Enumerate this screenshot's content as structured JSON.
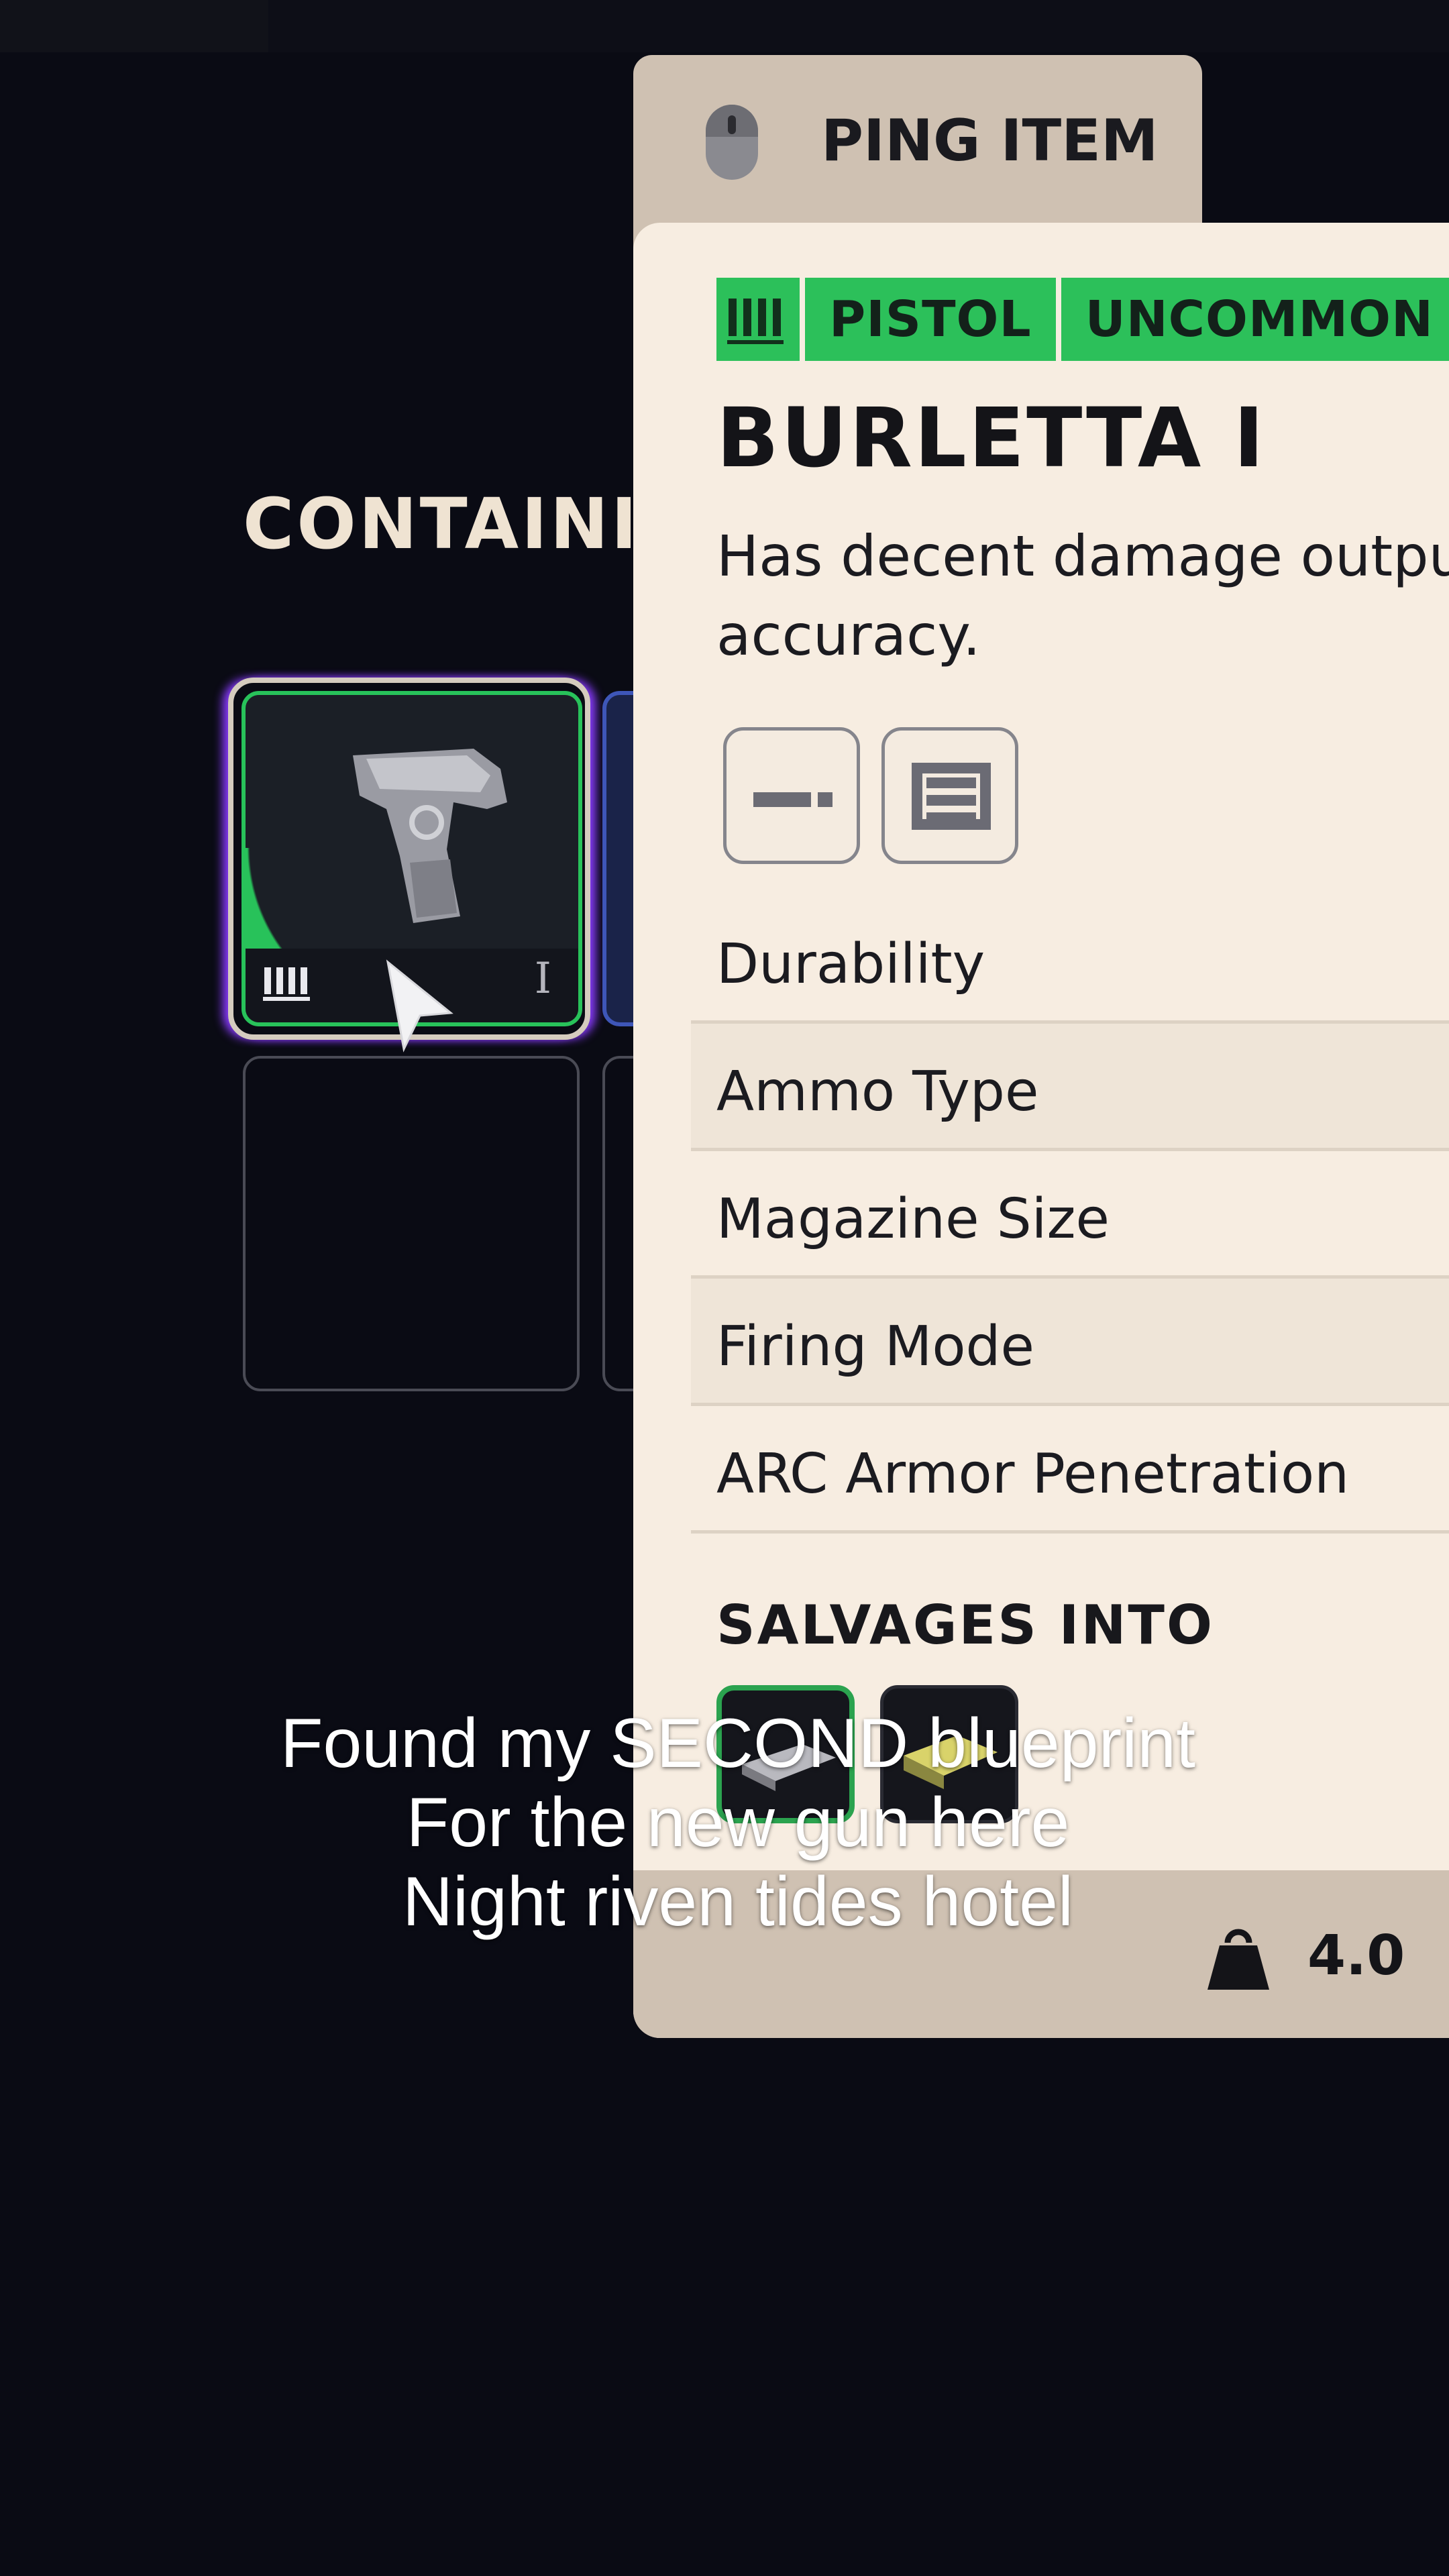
{
  "section": {
    "title": "CONTAINI"
  },
  "ping": {
    "label": "PING ITEM"
  },
  "item": {
    "tags": [
      "PISTOL",
      "UNCOMMON"
    ],
    "name": "BURLETTA I",
    "description": "Has decent damage outpu accuracy.",
    "tier": "I",
    "stats": [
      "Durability",
      "Ammo Type",
      "Magazine Size",
      "Firing Mode",
      "ARC Armor Penetration"
    ],
    "salvages_title": "SALVAGES INTO",
    "weight": "4.0"
  },
  "caption": {
    "lines": [
      "Found my SECOND blueprint",
      "For the new gun here",
      "Night riven tides hotel"
    ]
  },
  "colors": {
    "accent": "#2cc05a",
    "panel": "#f7ede1",
    "tab": "#cfc1b2",
    "background": "#0a0b14"
  },
  "icons": [
    "mouse-icon",
    "ammo-icon",
    "attachment-icon",
    "magazine-icon",
    "weight-icon",
    "cursor-icon"
  ]
}
